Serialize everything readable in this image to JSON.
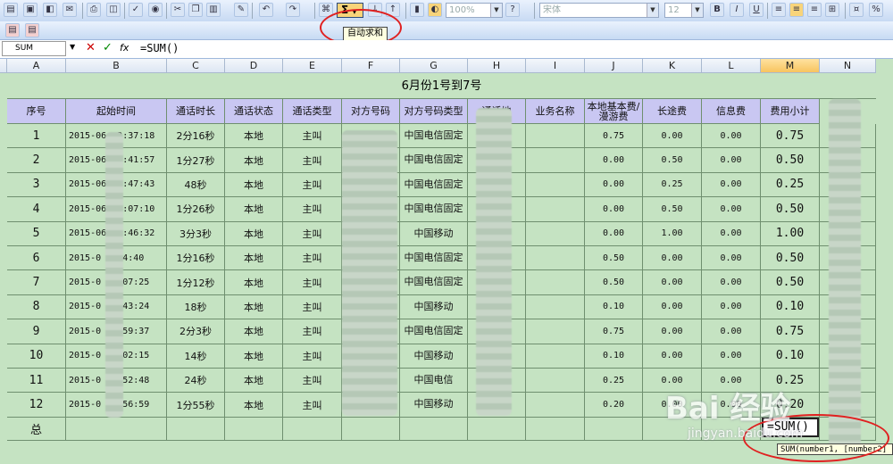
{
  "toolbar": {
    "zoom": "100%",
    "font_name": "宋体",
    "font_size": "12",
    "bold_label": "B",
    "italic_label": "I",
    "underline_label": "U",
    "percent_label": "%",
    "autosum_symbol": "Σ",
    "autosum_tooltip": "自动求和"
  },
  "formula_bar": {
    "name_box": "SUM",
    "cancel_symbol": "✕",
    "enter_symbol": "✓",
    "fx_symbol": "fx",
    "formula": "=SUM()"
  },
  "columns": [
    "A",
    "B",
    "C",
    "D",
    "E",
    "F",
    "G",
    "H",
    "I",
    "J",
    "K",
    "L",
    "M",
    "N"
  ],
  "sheet": {
    "title": "6月份1号到7号",
    "headers": [
      "序号",
      "起始时间",
      "通话时长",
      "通话状态",
      "通话类型",
      "对方号码",
      "对方号码类型",
      "通话地",
      "业务名称",
      "本地基本费/漫游费",
      "长途费",
      "信息费",
      "费用小计"
    ],
    "rows": [
      {
        "n": "1",
        "time": "2015-06-  3:37:18",
        "dur": "2分16秒",
        "status": "本地",
        "type": "主叫",
        "num": "",
        "ntype": "中国电信固定",
        "base": "0.75",
        "ld": "0.00",
        "info": "0.00",
        "sub": "0.75"
      },
      {
        "n": "2",
        "time": "2015-06-  3:41:57",
        "dur": "1分27秒",
        "status": "本地",
        "type": "主叫",
        "num": "0",
        "ntype": "中国电信固定",
        "base": "0.00",
        "ld": "0.50",
        "info": "0.00",
        "sub": "0.50"
      },
      {
        "n": "3",
        "time": "2015-06-  3:47:43",
        "dur": "48秒",
        "status": "本地",
        "type": "主叫",
        "num": "05",
        "ntype": "中国电信固定",
        "base": "0.00",
        "ld": "0.25",
        "info": "0.00",
        "sub": "0.25"
      },
      {
        "n": "4",
        "time": "2015-06-  4:07:10",
        "dur": "1分26秒",
        "status": "本地",
        "type": "主叫",
        "num": "05",
        "ntype": "中国电信固定",
        "base": "0.00",
        "ld": "0.50",
        "info": "0.00",
        "sub": "0.50"
      },
      {
        "n": "5",
        "time": "2015-06-  4:46:32",
        "dur": "3分3秒",
        "status": "本地",
        "type": "主叫",
        "num": "",
        "ntype": "中国移动",
        "base": "0.00",
        "ld": "1.00",
        "info": "0.00",
        "sub": "1.00"
      },
      {
        "n": "6",
        "time": "2015-0    4:54:40",
        "dur": "1分16秒",
        "status": "本地",
        "type": "主叫",
        "num": "",
        "ntype": "中国电信固定",
        "base": "0.50",
        "ld": "0.00",
        "info": "0.00",
        "sub": "0.50"
      },
      {
        "n": "7",
        "time": "2015-0    11:07:25",
        "dur": "1分12秒",
        "status": "本地",
        "type": "主叫",
        "num": "",
        "ntype": "中国电信固定",
        "base": "0.50",
        "ld": "0.00",
        "info": "0.00",
        "sub": "0.50"
      },
      {
        "n": "8",
        "time": "2015-0    12:43:24",
        "dur": "18秒",
        "status": "本地",
        "type": "主叫",
        "num": "1",
        "ntype": "中国移动",
        "base": "0.10",
        "ld": "0.00",
        "info": "0.00",
        "sub": "0.10"
      },
      {
        "n": "9",
        "time": "2015-0    16:59:37",
        "dur": "2分3秒",
        "status": "本地",
        "type": "主叫",
        "num": "8",
        "ntype": "中国电信固定",
        "base": "0.75",
        "ld": "0.00",
        "info": "0.00",
        "sub": "0.75"
      },
      {
        "n": "10",
        "time": "2015-0    17:02:15",
        "dur": "14秒",
        "status": "本地",
        "type": "主叫",
        "num": "1",
        "ntype": "中国移动",
        "base": "0.10",
        "ld": "0.00",
        "info": "0.00",
        "sub": "0.10"
      },
      {
        "n": "11",
        "time": "2015-0    10:52:48",
        "dur": "24秒",
        "status": "本地",
        "type": "主叫",
        "num": "18",
        "ntype": "中国电信",
        "base": "0.25",
        "ld": "0.00",
        "info": "0.00",
        "sub": "0.25"
      },
      {
        "n": "12",
        "time": "2015-0    10:56:59",
        "dur": "1分55秒",
        "status": "本地",
        "type": "主叫",
        "num": "",
        "ntype": "中国移动",
        "base": "0.20",
        "ld": "0.00",
        "info": "0.00",
        "sub": "0.20"
      }
    ],
    "total_label": "总",
    "edit_text": "=SUM()",
    "fn_hint": "SUM(number1, [number2]"
  },
  "watermark": {
    "main": "Bai 经验",
    "sub": "jingyan.baidu.com"
  }
}
